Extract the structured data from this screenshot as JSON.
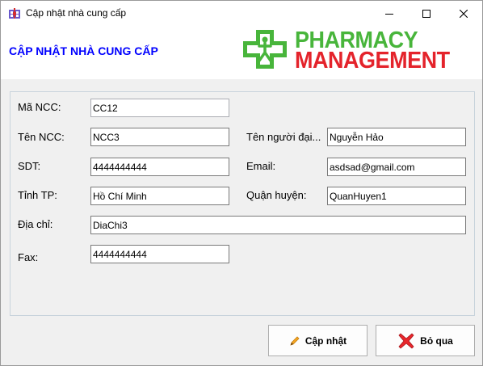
{
  "window": {
    "title": "Cập nhật nhà cung cấp"
  },
  "header": {
    "title": "CẬP NHẬT NHÀ CUNG CẤP",
    "logo_line1": "PHARMACY",
    "logo_line2": "MANAGEMENT"
  },
  "form": {
    "ma_ncc": {
      "label": "Mã NCC:",
      "value": "CC12"
    },
    "ten_ncc": {
      "label": "Tên NCC:",
      "value": "NCC3"
    },
    "ten_nguoi_dai": {
      "label": "Tên người đại...",
      "value": "Nguyễn Hảo"
    },
    "sdt": {
      "label": "SDT:",
      "value": "4444444444"
    },
    "email": {
      "label": "Email:",
      "value": "asdsad@gmail.com"
    },
    "tinh_tp": {
      "label": "Tỉnh TP:",
      "value": "Hồ Chí Minh"
    },
    "quan_huyen": {
      "label": "Quận huyện:",
      "value": "QuanHuyen1"
    },
    "dia_chi": {
      "label": "Địa chỉ:",
      "value": "DiaChi3"
    },
    "fax": {
      "label": "Fax:",
      "value": "4444444444"
    }
  },
  "buttons": {
    "update_label": "Cập nhật",
    "cancel_label": "Bỏ qua"
  },
  "colors": {
    "header_title": "#0000ff",
    "logo_green": "#48b53b",
    "logo_red": "#e4232b"
  },
  "icons": {
    "app": "app-icon",
    "minimize": "minimize-icon",
    "maximize": "maximize-icon",
    "close": "close-icon",
    "logo": "pharmacy-cross-icon",
    "update": "pencil-icon",
    "cancel": "red-x-icon"
  }
}
